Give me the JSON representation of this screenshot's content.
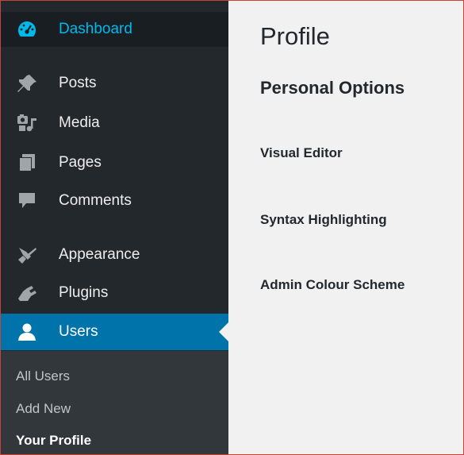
{
  "sidebar": {
    "items": [
      {
        "key": "dashboard",
        "label": "Dashboard",
        "icon": "dashboard-gauge-icon"
      },
      {
        "key": "posts",
        "label": "Posts",
        "icon": "pushpin-icon"
      },
      {
        "key": "media",
        "label": "Media",
        "icon": "media-camera-music-icon"
      },
      {
        "key": "pages",
        "label": "Pages",
        "icon": "pages-stack-icon"
      },
      {
        "key": "comments",
        "label": "Comments",
        "icon": "speech-bubble-icon"
      },
      {
        "key": "appearance",
        "label": "Appearance",
        "icon": "paintbrush-icon"
      },
      {
        "key": "plugins",
        "label": "Plugins",
        "icon": "plug-icon"
      },
      {
        "key": "users",
        "label": "Users",
        "icon": "user-icon"
      }
    ],
    "active": "Users",
    "submenu": [
      {
        "label": "All Users"
      },
      {
        "label": "Add New"
      },
      {
        "label": "Your Profile"
      }
    ],
    "current_submenu": "Your Profile"
  },
  "main": {
    "title": "Profile",
    "section_title": "Personal Options",
    "rows": [
      {
        "label": "Visual Editor"
      },
      {
        "label": "Syntax Highlighting"
      },
      {
        "label": "Admin Colour Scheme"
      }
    ]
  },
  "colors": {
    "sidebar_bg": "#23282d",
    "submenu_bg": "#32373c",
    "active_bg": "#0073aa",
    "dashboard_text": "#00b9eb",
    "content_bg": "#f1f1f1",
    "frame_border": "#c7443a"
  }
}
